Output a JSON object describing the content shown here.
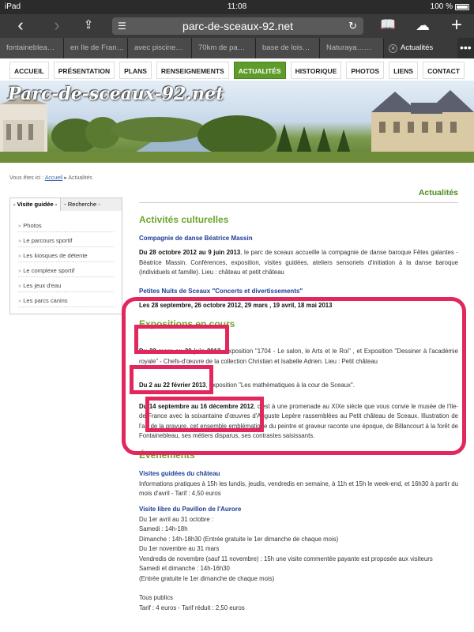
{
  "status_bar": {
    "device": "iPad",
    "time": "11:08",
    "battery": "100 %"
  },
  "browser": {
    "url": "parc-de-sceaux-92.net",
    "tabs": [
      "fontainebleа…",
      "en Ile de Fran…",
      "avec piscine…",
      "70km de pa…",
      "base de lois…",
      "Naturaya……"
    ],
    "active_tab": "Actualités",
    "icons": [
      "back-icon",
      "forward-icon",
      "share-icon",
      "bookmarks-icon",
      "cloud-icon",
      "new-tab-icon"
    ]
  },
  "site_nav": [
    "ACCUEIL",
    "PRÉSENTATION",
    "PLANS",
    "RENSEIGNEMENTS",
    "ACTUALITÉS",
    "HISTORIQUE",
    "PHOTOS",
    "LIENS",
    "CONTACT"
  ],
  "banner": {
    "logo": "Parc-de-sceaux-92.net"
  },
  "breadcrumb": {
    "prefix": "Vous êtes ici :",
    "home": "Accueil",
    "current": "Actualités"
  },
  "sidebar": {
    "tabs": [
      "- Visite guidée -",
      "- Recherche -"
    ],
    "items": [
      "Photos",
      "Le parcours sportif",
      "Les kiosques de détente",
      "Le complexe sportif",
      "Les jeux d'eau",
      "Les parcs canins"
    ]
  },
  "main": {
    "page_title": "Actualités",
    "section1_title": "Activités culturelles",
    "ev1_title": "Compagnie de danse Béatrice Massin",
    "ev1_dates": "Du 28 octobre 2012 au 9 juin 2013",
    "ev1_text": ", le parc de sceaux accueille la compagnie de danse baroque Fêtes galantes - Béatrice Massin. Conférences, exposition, visites guidées, ateliers sensoriels d'initiation à la danse baroque (individuels et famille). Lieu : château et petit château",
    "ev2_title": "Petites Nuits de Sceaux \"Concerts et divertissements\"",
    "ev2_text": "Les 28 septembre, 26 octobre 2012, 29 mars , 19 avril, 18 mai 2013",
    "section2_title": "Expositions en cours",
    "exp1_dates": "Du 22 mars au 30 juin 2013",
    "exp1_text": ", Exposition \"1704 - Le salon, le Arts et le Roi\" , et Exposition \"Dessiner à l'académie royale\" - Chefs-d'œuvre de la collection Christian et Isabelle Adrien. Lieu : Petit château",
    "exp2_dates": "Du 2 au 22 février 2013",
    "exp2_text": ", exposition \"Les mathématiques à la cour de Sceaux\".",
    "exp3_dates": "Du 14 septembre au 16 décembre 2012",
    "exp3_text": ", c'est à une promenade au XIXe siècle que vous convie le musée de l'Ile-de-France avec la soixantaine d'œuvres d'Auguste Lepère rassemblées au Petit château de Sceaux. Illustration de l'art de la gravure, cet ensemble emblématique du peintre et graveur raconte une époque, de Billancourt à la forêt de Fontainebleau, ses métiers disparus, ses contrastes saisissants.",
    "section3_title": "Évènements",
    "ev3_title": "Visites guidées du château",
    "ev3_text": "Informations pratiques à 15h les lundis, jeudis, vendredis en semaine, à 11h et 15h le week-end, et 16h30 à partir du mois d'avril - Tarif : 4,50 euros",
    "ev4_title": "Visite libre du Pavillon de l'Aurore",
    "ev4_lines": [
      "Du 1er avril au 31 octobre :",
      "Samedi : 14h-18h",
      "Dimanche : 14h-18h30 (Entrée gratuite le 1er dimanche de chaque mois)",
      "Du 1er novembre au 31 mars",
      "Vendredis de novembre (sauf 11 novembre) : 15h une visite commentée payante est proposée aux visiteurs",
      "Samedi et dimanche : 14h-16h30",
      "(Entrée gratuite le 1er dimanche de chaque mois)",
      "",
      "Tous publics",
      "Tarif : 4 euros - Tarif réduit : 2,50 euros"
    ]
  }
}
